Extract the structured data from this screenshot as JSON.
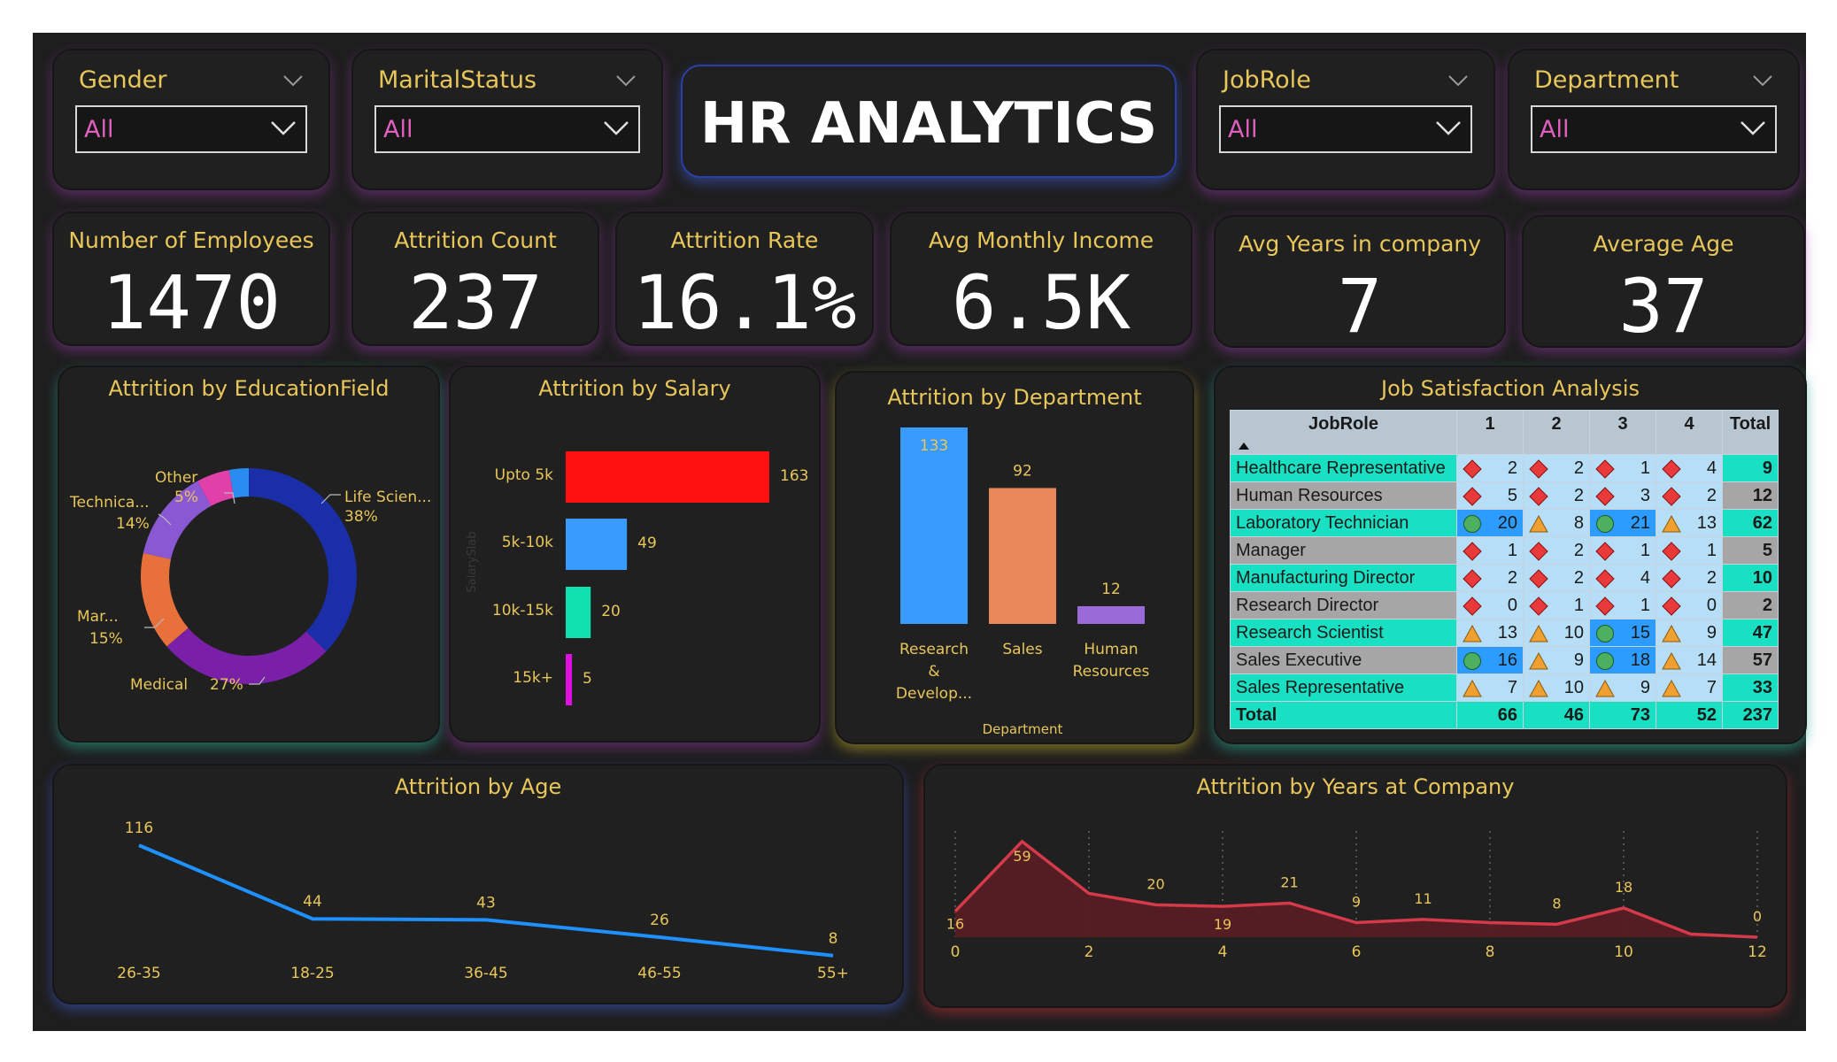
{
  "title": "HR ANALYTICS",
  "colors": {
    "accent_gold": "#e8c65a",
    "filter_value": "#e060c0",
    "background": "#1e1e1e",
    "card": "#202020"
  },
  "filters": [
    {
      "label": "Gender",
      "value": "All"
    },
    {
      "label": "MaritalStatus",
      "value": "All"
    },
    {
      "label": "JobRole",
      "value": "All"
    },
    {
      "label": "Department",
      "value": "All"
    }
  ],
  "kpis": [
    {
      "label": "Number of Employees",
      "value": "1470"
    },
    {
      "label": "Attrition Count",
      "value": "237"
    },
    {
      "label": "Attrition Rate",
      "value": "16.1%"
    },
    {
      "label": "Avg Monthly Income",
      "value": "6.5K"
    },
    {
      "label": "Avg Years in company",
      "value": "7"
    },
    {
      "label": "Average Age",
      "value": "37"
    }
  ],
  "chart_data": [
    {
      "type": "pie",
      "title": "Attrition by EducationField",
      "slices": [
        {
          "label": "Life Scien...",
          "pct_label": "38%",
          "value": 38,
          "color": "#1a2ea8"
        },
        {
          "label": "Medical",
          "pct_label": "27%",
          "value": 27,
          "color": "#7a1fa8"
        },
        {
          "label": "Mar...",
          "pct_label": "15%",
          "value": 15,
          "color": "#e8703a"
        },
        {
          "label": "Technica...",
          "pct_label": "14%",
          "value": 14,
          "color": "#8a58d2"
        },
        {
          "label": "Other",
          "pct_label": "5%",
          "value": 5,
          "color": "#e040a8"
        },
        {
          "label": "",
          "pct_label": "",
          "value": 3,
          "color": "#2a8cf0"
        }
      ]
    },
    {
      "type": "bar",
      "orientation": "horizontal",
      "title": "Attrition by Salary",
      "ylabel": "SalarySlab",
      "categories": [
        "Upto 5k",
        "5k-10k",
        "10k-15k",
        "15k+"
      ],
      "values": [
        163,
        49,
        20,
        5
      ],
      "colors": [
        "#ff1010",
        "#3a9bff",
        "#10e0b0",
        "#e010e0"
      ]
    },
    {
      "type": "bar",
      "title": "Attrition by Department",
      "xlabel": "Department",
      "categories": [
        "Research & Develop...",
        "Sales",
        "Human Resources"
      ],
      "category_lines": [
        [
          "Research",
          "&",
          "Develop..."
        ],
        [
          "Sales"
        ],
        [
          "Human",
          "Resources"
        ]
      ],
      "values": [
        133,
        92,
        12
      ],
      "colors": [
        "#3a9bff",
        "#e8875a",
        "#9a6ad8"
      ]
    },
    {
      "type": "table",
      "title": "Job Satisfaction Analysis",
      "columns": [
        "JobRole",
        "1",
        "2",
        "3",
        "4",
        "Total"
      ],
      "rows": [
        {
          "role": "Healthcare Representative",
          "values": [
            2,
            2,
            1,
            4
          ],
          "total": 9,
          "shapes": [
            "d",
            "d",
            "d",
            "d"
          ]
        },
        {
          "role": "Human Resources",
          "values": [
            5,
            2,
            3,
            2
          ],
          "total": 12,
          "shapes": [
            "d",
            "d",
            "d",
            "d"
          ]
        },
        {
          "role": "Laboratory Technician",
          "values": [
            20,
            8,
            21,
            13
          ],
          "total": 62,
          "shapes": [
            "c",
            "t",
            "c",
            "t"
          ]
        },
        {
          "role": "Manager",
          "values": [
            1,
            2,
            1,
            1
          ],
          "total": 5,
          "shapes": [
            "d",
            "d",
            "d",
            "d"
          ]
        },
        {
          "role": "Manufacturing Director",
          "values": [
            2,
            2,
            4,
            2
          ],
          "total": 10,
          "shapes": [
            "d",
            "d",
            "d",
            "d"
          ]
        },
        {
          "role": "Research Director",
          "values": [
            0,
            1,
            1,
            0
          ],
          "total": 2,
          "shapes": [
            "d",
            "d",
            "d",
            "d"
          ]
        },
        {
          "role": "Research Scientist",
          "values": [
            13,
            10,
            15,
            9
          ],
          "total": 47,
          "shapes": [
            "t",
            "t",
            "c",
            "t"
          ]
        },
        {
          "role": "Sales Executive",
          "values": [
            16,
            9,
            18,
            14
          ],
          "total": 57,
          "shapes": [
            "c",
            "t",
            "c",
            "t"
          ]
        },
        {
          "role": "Sales Representative",
          "values": [
            7,
            10,
            9,
            7
          ],
          "total": 33,
          "shapes": [
            "t",
            "t",
            "t",
            "t"
          ]
        }
      ],
      "totals": {
        "label": "Total",
        "values": [
          66,
          46,
          73,
          52
        ],
        "total": 237
      }
    },
    {
      "type": "line",
      "title": "Attrition by Age",
      "categories": [
        "26-35",
        "18-25",
        "36-45",
        "46-55",
        "55+"
      ],
      "values": [
        116,
        44,
        43,
        26,
        8
      ],
      "color": "#1e90ff"
    },
    {
      "type": "area",
      "title": "Attrition by Years at Company",
      "x": [
        0,
        1,
        2,
        3,
        4,
        5,
        6,
        7,
        8,
        9,
        10,
        11,
        12
      ],
      "values": [
        16,
        59,
        20,
        19,
        21,
        9,
        11,
        8,
        18,
        0
      ],
      "points": [
        {
          "x": 0,
          "y": 16
        },
        {
          "x": 1,
          "y": 59
        },
        {
          "x": 2,
          "y": 27
        },
        {
          "x": 3,
          "y": 20
        },
        {
          "x": 4,
          "y": 19
        },
        {
          "x": 5,
          "y": 21
        },
        {
          "x": 6,
          "y": 9
        },
        {
          "x": 7,
          "y": 11
        },
        {
          "x": 8,
          "y": 9
        },
        {
          "x": 9,
          "y": 8
        },
        {
          "x": 10,
          "y": 18
        },
        {
          "x": 11,
          "y": 2
        },
        {
          "x": 12,
          "y": 0
        }
      ],
      "labeled": [
        0,
        1,
        3,
        4,
        5,
        6,
        7,
        9,
        10,
        12
      ],
      "xticks": [
        "0",
        "2",
        "4",
        "6",
        "8",
        "10",
        "12"
      ],
      "xlim": [
        0,
        12
      ],
      "color": "#d43a4a"
    }
  ]
}
